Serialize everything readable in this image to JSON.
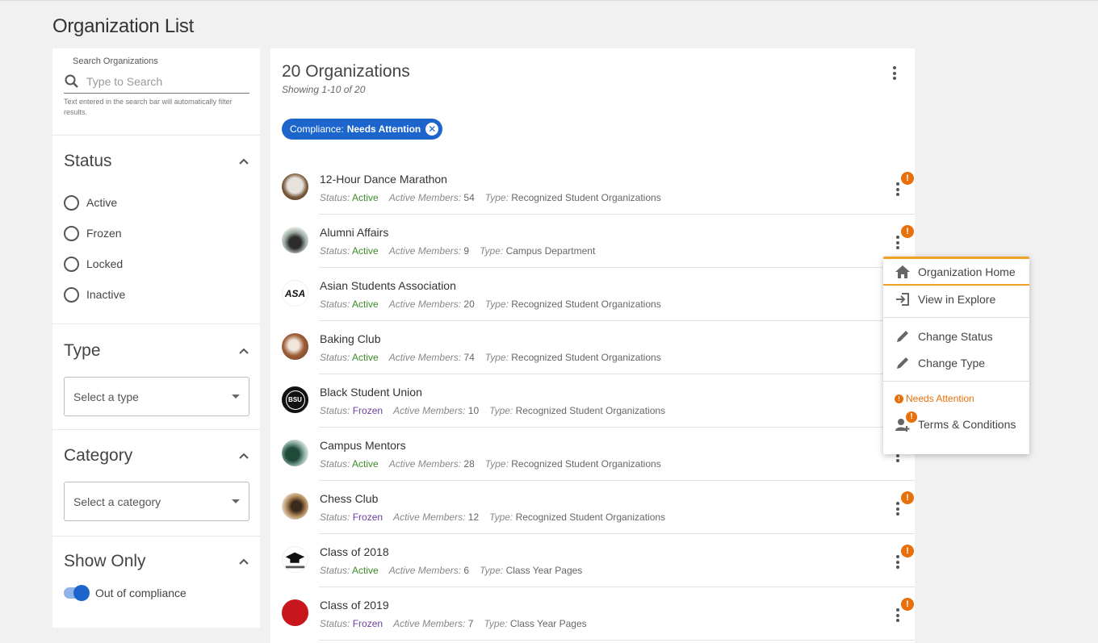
{
  "page_title": "Organization List",
  "search": {
    "label": "Search Organizations",
    "placeholder": "Type to Search",
    "hint": "Text entered in the search bar will automatically filter results."
  },
  "filters": {
    "status": {
      "title": "Status",
      "options": [
        "Active",
        "Frozen",
        "Locked",
        "Inactive"
      ]
    },
    "type": {
      "title": "Type",
      "placeholder": "Select a type"
    },
    "category": {
      "title": "Category",
      "placeholder": "Select a category"
    },
    "show_only": {
      "title": "Show Only",
      "toggle_label": "Out of compliance",
      "toggle_on": true
    }
  },
  "main": {
    "count_title": "20 Organizations",
    "showing": "Showing 1-10 of 20",
    "chip": {
      "prefix": "Compliance:",
      "value": "Needs Attention"
    },
    "labels": {
      "status": "Status:",
      "members": "Active Members:",
      "type": "Type:"
    }
  },
  "organizations": [
    {
      "name": "12-Hour Dance Marathon",
      "status": "Active",
      "members": "54",
      "type": "Recognized Student Organizations",
      "alert": true
    },
    {
      "name": "Alumni Affairs",
      "status": "Active",
      "members": "9",
      "type": "Campus Department",
      "alert": true
    },
    {
      "name": "Asian Students Association",
      "status": "Active",
      "members": "20",
      "type": "Recognized Student Organizations",
      "alert": false
    },
    {
      "name": "Baking Club",
      "status": "Active",
      "members": "74",
      "type": "Recognized Student Organizations",
      "alert": false
    },
    {
      "name": "Black Student Union",
      "status": "Frozen",
      "members": "10",
      "type": "Recognized Student Organizations",
      "alert": false
    },
    {
      "name": "Campus Mentors",
      "status": "Active",
      "members": "28",
      "type": "Recognized Student Organizations",
      "alert": false
    },
    {
      "name": "Chess Club",
      "status": "Frozen",
      "members": "12",
      "type": "Recognized Student Organizations",
      "alert": true
    },
    {
      "name": "Class of 2018",
      "status": "Active",
      "members": "6",
      "type": "Class Year Pages",
      "alert": true
    },
    {
      "name": "Class of 2019",
      "status": "Frozen",
      "members": "7",
      "type": "Class Year Pages",
      "alert": true
    }
  ],
  "avatars": [
    "ASA",
    "BSU"
  ],
  "menu": {
    "items_top": [
      "Organization Home",
      "View in Explore"
    ],
    "items_mid": [
      "Change Status",
      "Change Type"
    ],
    "warning": "Needs Attention",
    "terms": "Terms & Conditions"
  },
  "colors": {
    "accent": "#1c65cc",
    "alert": "#e8700a",
    "active": "#3d8a2a",
    "frozen": "#6b3fa0",
    "menu_highlight": "#f0a024"
  }
}
